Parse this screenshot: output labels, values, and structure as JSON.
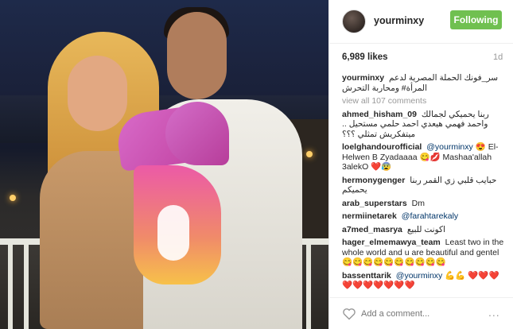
{
  "header": {
    "username": "yourminxy",
    "follow_label": "Following"
  },
  "stats": {
    "likes": "6,989 likes",
    "time": "1d"
  },
  "caption": {
    "user": "yourminxy",
    "text": "سر_فونك الحملة المصرية لدعم المرأة# ومحاربة التحرش"
  },
  "view_all": "view all 107 comments",
  "comments": [
    {
      "user": "ahmed_hisham_09",
      "text": "ربنا يحميكي لجمالك واحمد فهمي هيعدي احمد حلمي مستحيل .. ميتفكريش تمثلي ؟؟؟",
      "rtl": true
    },
    {
      "user": "loelghandourofficial",
      "mention": "@yourminxy",
      "text": "😍 El-Helwen B Zyadaaaa 😋💋 Mashaa'allah 3alekO ❤️😰"
    },
    {
      "user": "hermonygenger",
      "text": "حبايب قلبي زي القمر ربنا يحميكم",
      "rtl": true
    },
    {
      "user": "arab_superstars",
      "text": "Dm"
    },
    {
      "user": "nermiinetarek",
      "mention": "@farahtarekaly",
      "text": ""
    },
    {
      "user": "a7med_masrya",
      "text": "اكونت للبيع",
      "rtl": true
    },
    {
      "user": "hager_elmemawya_team",
      "text": "Least two in the whole world and u are beautiful and gentel 😋😋😋😋😋😋😋😋😋😋"
    },
    {
      "user": "bassenttarik",
      "mention": "@yourminxy",
      "text": "💪💪 ❤️❤️❤️❤️❤️❤️❤️❤️❤️❤️"
    }
  ],
  "footer": {
    "comment_placeholder": "Add a comment...",
    "more": "..."
  }
}
